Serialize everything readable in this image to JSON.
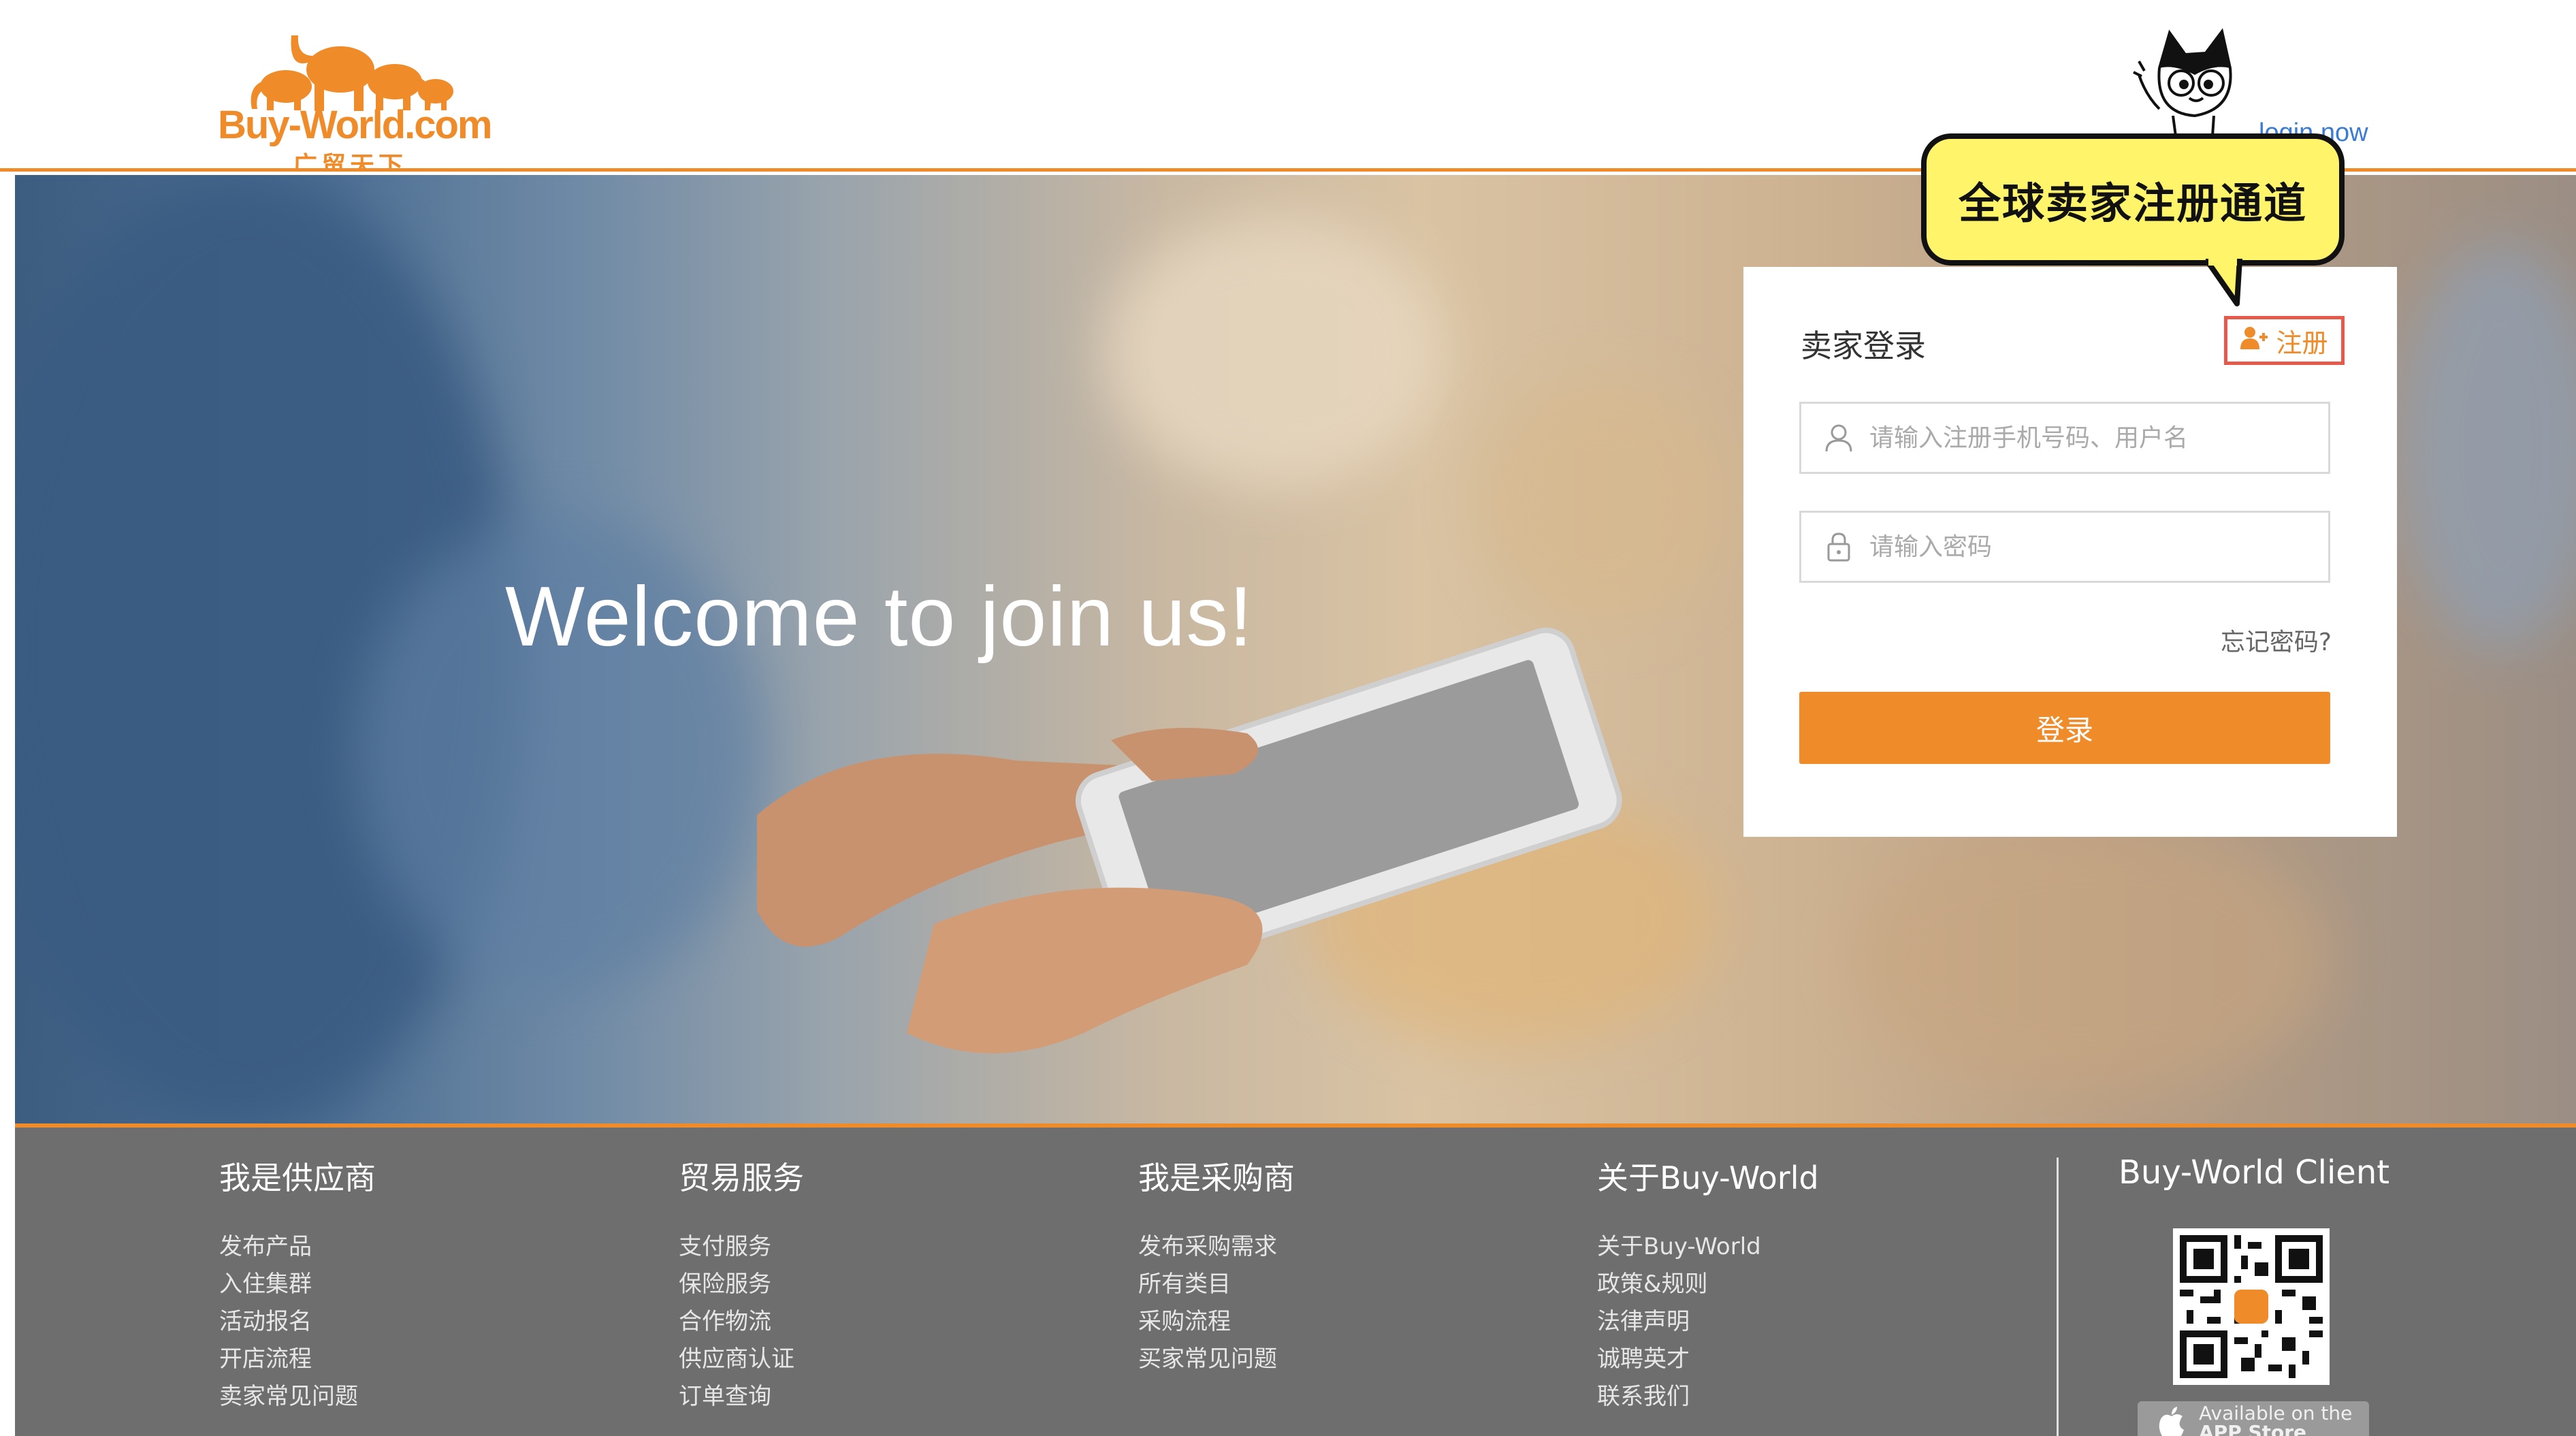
{
  "header": {
    "logo_text": "Buy-World.com",
    "logo_subtext": "广贸天下",
    "login_link": "login now"
  },
  "hero": {
    "welcome": "Welcome to join us!"
  },
  "login": {
    "title": "卖家登录",
    "register_label": "注册",
    "username_placeholder": "请输入注册手机号码、用户名",
    "password_placeholder": "请输入密码",
    "forgot": "忘记密码?",
    "submit": "登录"
  },
  "bubble": {
    "text": "全球卖家注册通道"
  },
  "footer": {
    "columns": [
      {
        "title": "我是供应商",
        "items": [
          "发布产品",
          "入住集群",
          "活动报名",
          "开店流程",
          "卖家常见问题"
        ]
      },
      {
        "title": "贸易服务",
        "items": [
          "支付服务",
          "保险服务",
          "合作物流",
          "供应商认证",
          "订单查询"
        ]
      },
      {
        "title": "我是采购商",
        "items": [
          "发布采购需求",
          "所有类目",
          "采购流程",
          "买家常见问题"
        ]
      },
      {
        "title": "关于Buy-World",
        "items": [
          "关于Buy-World",
          "政策&规则",
          "法律声明",
          "诚聘英才",
          "联系我们"
        ]
      }
    ],
    "client_title": "Buy-World Client",
    "appstore_line1": "Available on the",
    "appstore_line2": "APP Store"
  },
  "colors": {
    "accent": "#f08b2a",
    "footer_bg": "#6e6e6e",
    "bubble": "#fff46a",
    "register_border": "#e55a4a",
    "link": "#3a7bd5"
  },
  "icons": {
    "user": "user-icon",
    "lock": "lock-icon",
    "add_user": "add-user-icon",
    "apple": "apple-icon"
  }
}
